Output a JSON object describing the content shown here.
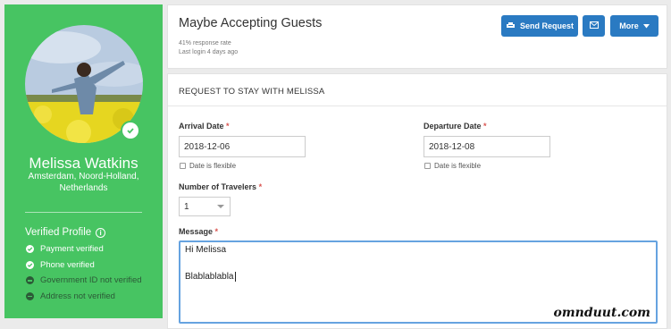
{
  "profile": {
    "name": "Melissa Watkins",
    "location": "Amsterdam, Noord-Holland, Netherlands",
    "verified_title": "Verified Profile",
    "verifications": [
      {
        "label": "Payment verified",
        "verified": true
      },
      {
        "label": "Phone verified",
        "verified": true
      },
      {
        "label": "Government ID not verified",
        "verified": false
      },
      {
        "label": "Address not verified",
        "verified": false
      }
    ]
  },
  "header": {
    "title": "Maybe Accepting Guests",
    "response_rate": "41% response rate",
    "last_login": "Last login 4 days ago",
    "send_request_label": "Send Request",
    "more_label": "More"
  },
  "request": {
    "title": "REQUEST TO STAY WITH MELISSA",
    "arrival_label": "Arrival Date",
    "arrival_value": "2018-12-06",
    "departure_label": "Departure Date",
    "departure_value": "2018-12-08",
    "flexible_label": "Date is flexible",
    "travelers_label": "Number of Travelers",
    "travelers_value": "1",
    "message_label": "Message",
    "message_line1": "Hi Melissa",
    "message_line2": "Blablablabla",
    "required_mark": "*"
  },
  "watermark": "omnduut.com",
  "colors": {
    "sidebar_green": "#47c462",
    "button_blue": "#2a7ac2",
    "focus_blue": "#66a3e0",
    "required_red": "#d9534f"
  }
}
